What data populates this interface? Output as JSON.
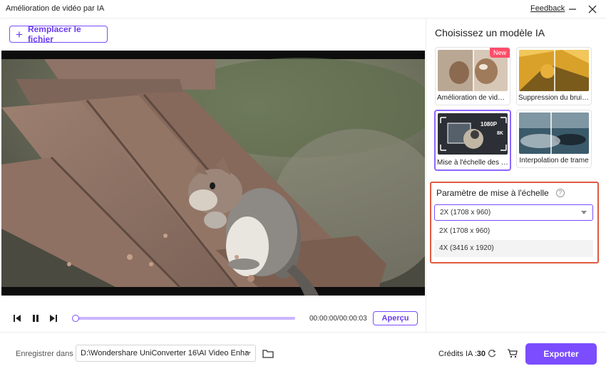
{
  "window": {
    "title": "Amélioration de vidéo par IA",
    "feedback_label": "Feedback"
  },
  "toolbar": {
    "replace_label": "Remplacer le fichier"
  },
  "player": {
    "timecode": "00:00:00/00:00:03",
    "preview_label": "Aperçu",
    "progress_fraction": 0.0
  },
  "models": {
    "heading": "Choisissez un modèle IA",
    "items": [
      {
        "label": "Amélioration de vidéos",
        "badge": "New",
        "selected": false
      },
      {
        "label": "Suppression du bruit ...",
        "badge": "",
        "selected": false
      },
      {
        "label": "Mise à l'échelle des vi...",
        "badge": "",
        "selected": true,
        "thumb_text_left": "1080P",
        "thumb_text_right": "8K"
      },
      {
        "label": "Interpolation de trame",
        "badge": "",
        "selected": false
      }
    ]
  },
  "scale_params": {
    "title": "Paramètre de mise à l'échelle",
    "selected": "2X (1708 x 960)",
    "options": [
      "2X (1708 x 960)",
      "4X (3416 x 1920)"
    ]
  },
  "footer": {
    "save_label": "Enregistrer dans",
    "save_path": "D:\\Wondershare UniConverter 16\\AI Video Enha",
    "credits_label": "Crédits IA :",
    "credits_value": "30",
    "export_label": "Exporter"
  },
  "colors": {
    "accent": "#7b4dff",
    "highlight_border": "#e05a3f",
    "new_badge": "#ff4d6a"
  }
}
